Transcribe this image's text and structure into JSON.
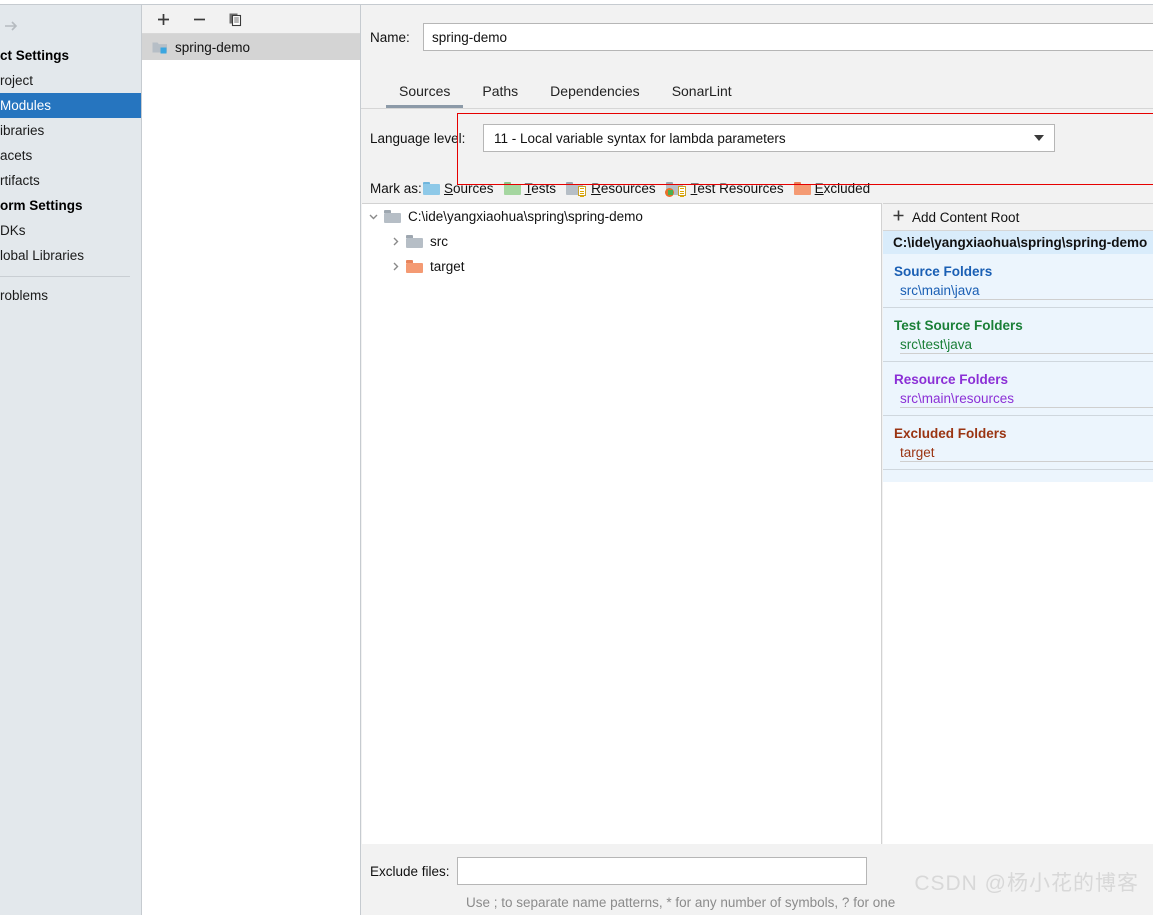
{
  "sidebar": {
    "collapse_icon": "arrow-right-icon",
    "groups": [
      {
        "label": "ct Settings",
        "type": "group"
      },
      {
        "label": "roject",
        "type": "leaf",
        "selected": false
      },
      {
        "label": "Modules",
        "type": "leaf",
        "selected": true
      },
      {
        "label": "ibraries",
        "type": "leaf",
        "selected": false
      },
      {
        "label": "acets",
        "type": "leaf",
        "selected": false
      },
      {
        "label": "rtifacts",
        "type": "leaf",
        "selected": false
      },
      {
        "label": "orm Settings",
        "type": "group"
      },
      {
        "label": "DKs",
        "type": "leaf",
        "selected": false
      },
      {
        "label": "lobal Libraries",
        "type": "leaf",
        "selected": false
      },
      {
        "label": "roblems",
        "type": "leaf",
        "selected": false
      }
    ]
  },
  "module_list": {
    "toolbar": {
      "add_icon": "plus-icon",
      "remove_icon": "minus-icon",
      "copy_icon": "copy-icon"
    },
    "items": [
      {
        "label": "spring-demo",
        "icon": "module-folder-icon",
        "selected": true
      }
    ]
  },
  "main": {
    "name_label": "Name:",
    "name_value": "spring-demo",
    "tabs": [
      {
        "label": "Sources",
        "active": true
      },
      {
        "label": "Paths",
        "active": false
      },
      {
        "label": "Dependencies",
        "active": false
      },
      {
        "label": "SonarLint",
        "active": false
      }
    ],
    "language_level": {
      "label": "Language level:",
      "value": "11 - Local variable syntax for lambda parameters",
      "caret_icon": "chevron-down-icon"
    },
    "mark_as": {
      "label": "Mark as:",
      "options": [
        {
          "label": "Sources",
          "mnemonic": "S",
          "rest": "ources",
          "color": "#8ec9e8",
          "tab_color": "#6fb6dd",
          "has_lines": false
        },
        {
          "label": "Tests",
          "mnemonic": "T",
          "rest": "ests",
          "color": "#a5d6a0",
          "tab_color": "#8ec489",
          "has_lines": false
        },
        {
          "label": "Resources",
          "mnemonic": "R",
          "rest": "esources",
          "color": "#b6bec6",
          "tab_color": "#9ea7b0",
          "has_lines": true
        },
        {
          "label": "Test Resources",
          "mnemonic": "T",
          "rest": "est Resources",
          "color": "#b6bec6",
          "tab_color": "#9ea7b0",
          "has_lines": true
        },
        {
          "label": "Excluded",
          "mnemonic": "E",
          "rest": "xcluded",
          "color": "#f49a73",
          "tab_color": "#e8845c",
          "has_lines": false
        }
      ]
    },
    "tree": {
      "root": {
        "label": "C:\\ide\\yangxiaohua\\spring\\spring-demo",
        "expand_icon": "chevron-down-icon",
        "folder_color": "#b6bec6",
        "folder_tab_color": "#9ea7b0"
      },
      "children": [
        {
          "label": "src",
          "expand_icon": "chevron-right-icon",
          "folder_color": "#b6bec6",
          "folder_tab_color": "#9ea7b0"
        },
        {
          "label": "target",
          "expand_icon": "chevron-right-icon",
          "folder_color": "#f49a73",
          "folder_tab_color": "#e8845c"
        }
      ]
    },
    "exclude_files": {
      "label": "Exclude files:",
      "value": "",
      "hint": "Use ; to separate name patterns, * for any number of symbols, ? for one"
    }
  },
  "right_panel": {
    "add_content_root": "Add Content Root",
    "add_icon": "plus-icon",
    "content_root": "C:\\ide\\yangxiaohua\\spring\\spring-demo",
    "sections": [
      {
        "title": "Source Folders",
        "color": "#1a5fb4",
        "items": [
          "src\\main\\java"
        ]
      },
      {
        "title": "Test Source Folders",
        "color": "#1a7f37",
        "items": [
          "src\\test\\java"
        ]
      },
      {
        "title": "Resource Folders",
        "color": "#8b2fd6",
        "items": [
          "src\\main\\resources"
        ]
      },
      {
        "title": "Excluded Folders",
        "color": "#9a3412",
        "items": [
          "target"
        ]
      }
    ]
  },
  "annotation": {
    "color": "#e60000",
    "shape": "rectangle"
  },
  "watermark": {
    "text": "CSDN @杨小花的博客"
  }
}
